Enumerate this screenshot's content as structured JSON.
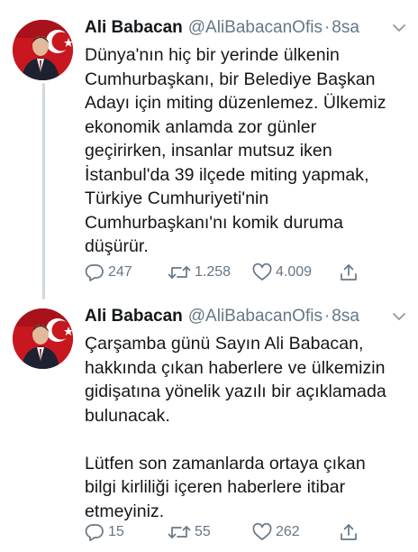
{
  "tweets": [
    {
      "author": "Ali Babacan",
      "handle": "@AliBabacanOfis",
      "separator": "·",
      "time": "8sa",
      "text": "Dünya'nın hiç bir yerinde ülkenin\nCumhurbaşkanı, bir Belediye Başkan\nAdayı için miting düzenlemez. Ülkemiz\nekonomik anlamda zor günler\ngeçirirken, insanlar mutsuz iken\nİstanbul'da 39 ilçede miting yapmak,\nTürkiye Cumhuriyeti'nin\nCumhurbaşkanı'nı komik duruma\ndüşürür.",
      "replies": "247",
      "retweets": "1.258",
      "likes": "4.009"
    },
    {
      "author": "Ali Babacan",
      "handle": "@AliBabacanOfis",
      "separator": "·",
      "time": "8sa",
      "text": "Çarşamba günü Sayın Ali Babacan,\nhakkında çıkan haberlere ve ülkemizin\ngidişatına yönelik yazılı bir açıklamada\nbulunacak.\n\nLütfen son zamanlarda ortaya çıkan\nbilgi kirliliği içeren haberlere itibar\netmeyiniz.",
      "replies": "15",
      "retweets": "55",
      "likes": "262"
    }
  ],
  "icons": {
    "reply": "reply-icon",
    "retweet": "retweet-icon",
    "like": "heart-icon",
    "share": "share-icon",
    "caret": "chevron-down-icon",
    "avatar": "avatar"
  },
  "colors": {
    "text": "#14171a",
    "muted": "#657786",
    "thread_line": "#cfd9de",
    "flag_red": "#d81f26"
  }
}
